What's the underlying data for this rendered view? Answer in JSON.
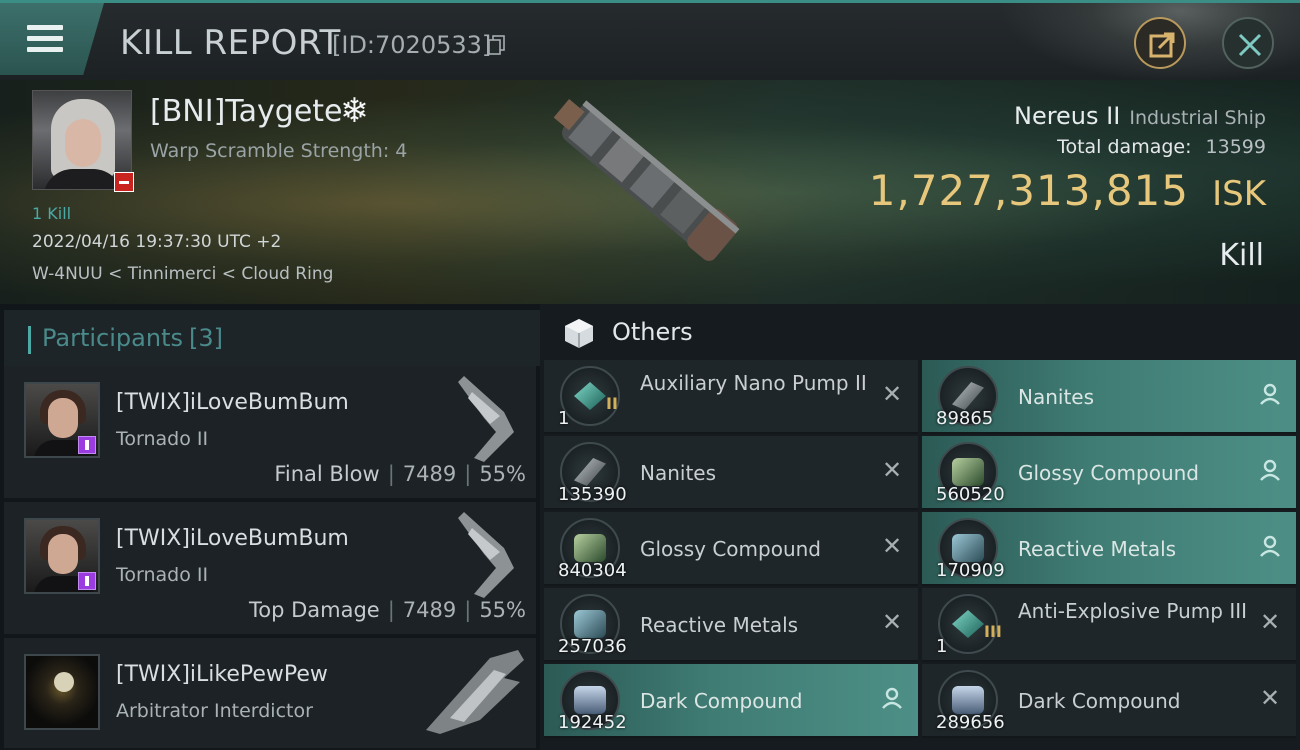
{
  "header": {
    "title": "KILL REPORT",
    "report_id": "[ID:7020533]",
    "menu_icon": "hamburger-menu-icon",
    "share_icon": "share-export-icon",
    "close_icon": "close-icon"
  },
  "victim": {
    "name": "[BNI]Taygete",
    "badge_icon": "snowflake-icon",
    "warp_scramble": "Warp Scramble Strength: 4",
    "kill_link": "1 Kill",
    "datetime": "2022/04/16 19:37:30 UTC +2",
    "location": "W-4NUU < Tinnimerci < Cloud Ring",
    "ship_name": "Nereus II",
    "ship_class": "Industrial Ship",
    "total_damage_label": "Total damage:",
    "total_damage": "13599",
    "isk_value": "1,727,313,815",
    "isk_unit": "ISK",
    "kill_type": "Kill"
  },
  "participants": {
    "title": "Participants",
    "count": "[3]",
    "items": [
      {
        "name": "[TWIX]iLoveBumBum",
        "ship": "Tornado II",
        "label": "Final Blow",
        "damage": "7489",
        "percent": "55%"
      },
      {
        "name": "[TWIX]iLoveBumBum",
        "ship": "Tornado II",
        "label": "Top Damage",
        "damage": "7489",
        "percent": "55%"
      },
      {
        "name": "[TWIX]iLikePewPew",
        "ship": "Arbitrator Interdictor",
        "label": "",
        "damage": "",
        "percent": ""
      }
    ]
  },
  "others": {
    "title": "Others",
    "items": [
      {
        "name": "Auxiliary Nano Pump II",
        "qty": "1",
        "meta": "II",
        "status": "destroyed",
        "icon": "pump-module-icon"
      },
      {
        "name": "Nanites",
        "qty": "89865",
        "meta": "",
        "status": "dropped",
        "icon": "nanites-icon"
      },
      {
        "name": "Nanites",
        "qty": "135390",
        "meta": "",
        "status": "destroyed",
        "icon": "nanites-icon"
      },
      {
        "name": "Glossy Compound",
        "qty": "560520",
        "meta": "",
        "status": "dropped",
        "icon": "glossy-compound-icon"
      },
      {
        "name": "Glossy Compound",
        "qty": "840304",
        "meta": "",
        "status": "destroyed",
        "icon": "glossy-compound-icon"
      },
      {
        "name": "Reactive Metals",
        "qty": "170909",
        "meta": "",
        "status": "dropped",
        "icon": "reactive-metals-icon"
      },
      {
        "name": "Reactive Metals",
        "qty": "257036",
        "meta": "",
        "status": "destroyed",
        "icon": "reactive-metals-icon"
      },
      {
        "name": "Anti-Explosive Pump III",
        "qty": "1",
        "meta": "III",
        "status": "destroyed",
        "icon": "pump-module-icon"
      },
      {
        "name": "Dark Compound",
        "qty": "192452",
        "meta": "",
        "status": "dropped",
        "icon": "dark-compound-icon"
      },
      {
        "name": "Dark Compound",
        "qty": "289656",
        "meta": "",
        "status": "destroyed",
        "icon": "dark-compound-icon"
      }
    ]
  },
  "colors": {
    "accent": "#4ba9a6",
    "isk_gold": "#e7c77b",
    "dropped_bg": "#3f7c74",
    "destroyed_bg": "#1f2629"
  }
}
